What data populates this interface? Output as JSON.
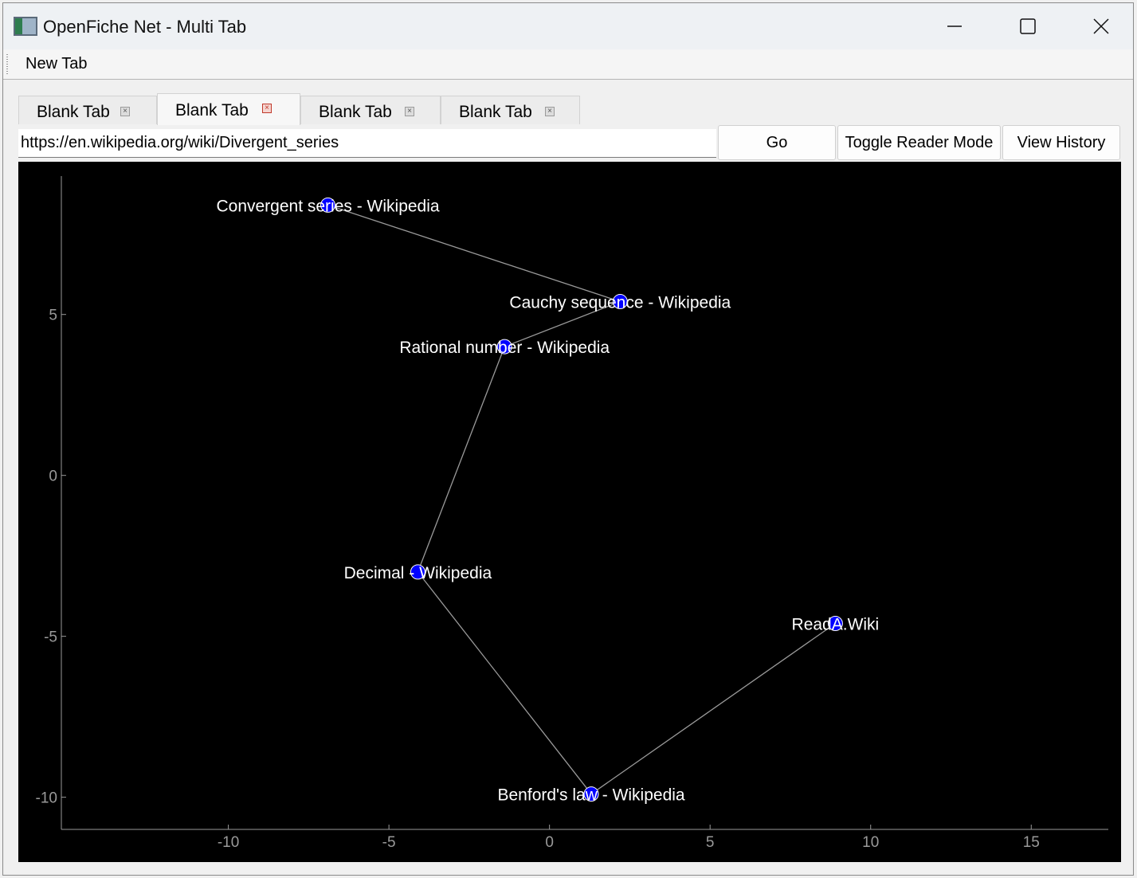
{
  "window": {
    "title": "OpenFiche Net - Multi Tab",
    "controls": {
      "minimize": "minimize",
      "maximize": "maximize",
      "close": "close"
    }
  },
  "menu": {
    "items": [
      {
        "label": "New Tab"
      }
    ]
  },
  "tabs": [
    {
      "label": "Blank Tab",
      "active": false
    },
    {
      "label": "Blank Tab",
      "active": true
    },
    {
      "label": "Blank Tab",
      "active": false
    },
    {
      "label": "Blank Tab",
      "active": false
    }
  ],
  "toolbar": {
    "url": "https://en.wikipedia.org/wiki/Divergent_series",
    "go_label": "Go",
    "reader_label": "Toggle Reader Mode",
    "history_label": "View History"
  },
  "chart_data": {
    "type": "scatter",
    "background": "#000000",
    "node_color": "#0000ff",
    "edge_color": "#9a9a9a",
    "xlim": [
      -15.2,
      17.4
    ],
    "ylim": [
      -11.0,
      9.3
    ],
    "xticks": [
      -10,
      -5,
      0,
      5,
      10,
      15
    ],
    "yticks": [
      5,
      0,
      -5,
      -10
    ],
    "nodes": [
      {
        "label": "Convergent series - Wikipedia",
        "x": -6.9,
        "y": 8.4
      },
      {
        "label": "Cauchy sequence - Wikipedia",
        "x": 2.2,
        "y": 5.4
      },
      {
        "label": "Rational number - Wikipedia",
        "x": -1.4,
        "y": 4.0
      },
      {
        "label": "Decimal - Wikipedia",
        "x": -4.1,
        "y": -3.0
      },
      {
        "label": "Benford's law - Wikipedia",
        "x": 1.3,
        "y": -9.9
      },
      {
        "label": "ReadA.Wiki",
        "x": 8.9,
        "y": -4.6
      }
    ],
    "edges": [
      [
        0,
        1
      ],
      [
        1,
        2
      ],
      [
        2,
        3
      ],
      [
        3,
        4
      ],
      [
        4,
        5
      ]
    ]
  }
}
